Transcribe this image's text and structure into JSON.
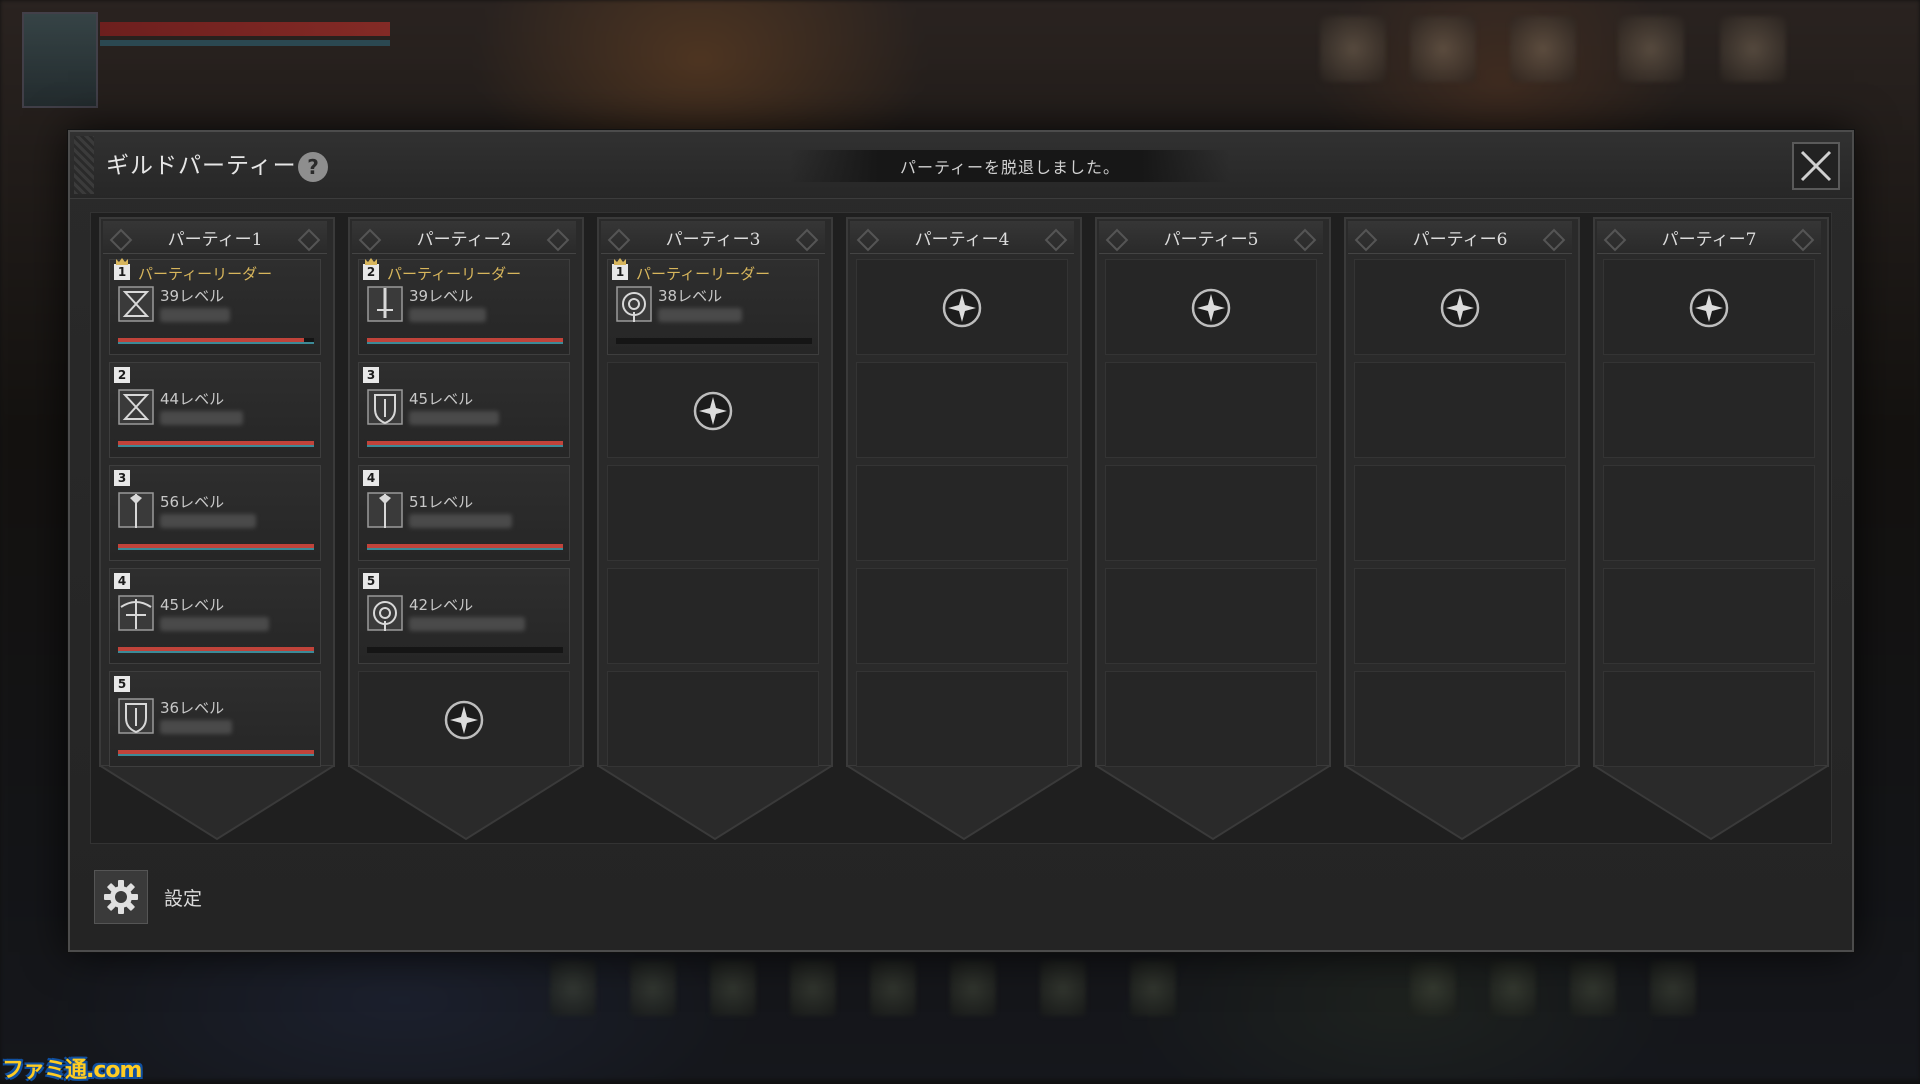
{
  "modal": {
    "title": "ギルドパーティー",
    "help": "?",
    "notice": "パーティーを脱退しました。"
  },
  "parties": [
    {
      "name": "パーティー1",
      "members": [
        {
          "slot": "1",
          "leader": true,
          "leader_label": "パーティーリーダー",
          "level": "39レベル",
          "class_icon": "hourglass-class-icon",
          "hp": 0.95,
          "mp": 1.0
        },
        {
          "slot": "2",
          "leader": false,
          "level": "44レベル",
          "class_icon": "hourglass-class-icon",
          "hp": 1.0,
          "mp": 1.0
        },
        {
          "slot": "3",
          "leader": false,
          "level": "56レベル",
          "class_icon": "staff-class-icon",
          "hp": 1.0,
          "mp": 1.0
        },
        {
          "slot": "4",
          "leader": false,
          "level": "45レベル",
          "class_icon": "crossbow-class-icon",
          "hp": 1.0,
          "mp": 1.0
        },
        {
          "slot": "5",
          "leader": false,
          "level": "36レベル",
          "class_icon": "shield-class-icon",
          "hp": 1.0,
          "mp": 1.0
        }
      ],
      "open_slots": 0
    },
    {
      "name": "パーティー2",
      "members": [
        {
          "slot": "2",
          "leader": true,
          "leader_label": "パーティーリーダー",
          "level": "39レベル",
          "class_icon": "sword-class-icon",
          "hp": 1.0,
          "mp": 1.0
        },
        {
          "slot": "3",
          "leader": false,
          "level": "45レベル",
          "class_icon": "shield-class-icon",
          "hp": 1.0,
          "mp": 1.0
        },
        {
          "slot": "4",
          "leader": false,
          "level": "51レベル",
          "class_icon": "staff-class-icon",
          "hp": 1.0,
          "mp": 1.0
        },
        {
          "slot": "5",
          "leader": false,
          "level": "42レベル",
          "class_icon": "orb-class-icon",
          "hp": 0.0,
          "mp": 0.0
        }
      ],
      "open_slots": 1
    },
    {
      "name": "パーティー3",
      "members": [
        {
          "slot": "1",
          "leader": true,
          "leader_label": "パーティーリーダー",
          "level": "38レベル",
          "class_icon": "orb-class-icon",
          "hp": 0.0,
          "mp": 0.0
        }
      ],
      "open_slots": 1
    },
    {
      "name": "パーティー4",
      "members": [],
      "open_slots": 1
    },
    {
      "name": "パーティー5",
      "members": [],
      "open_slots": 1
    },
    {
      "name": "パーティー6",
      "members": [],
      "open_slots": 1
    },
    {
      "name": "パーティー7",
      "members": [],
      "open_slots": 1
    }
  ],
  "footer": {
    "settings_label": "設定"
  },
  "watermark": "ファミ通.com",
  "colors": {
    "leader_gold": "#d8b65c",
    "hp_red": "#c0433a",
    "mp_teal": "#3c8a97",
    "panel": "#2a2a2a"
  }
}
